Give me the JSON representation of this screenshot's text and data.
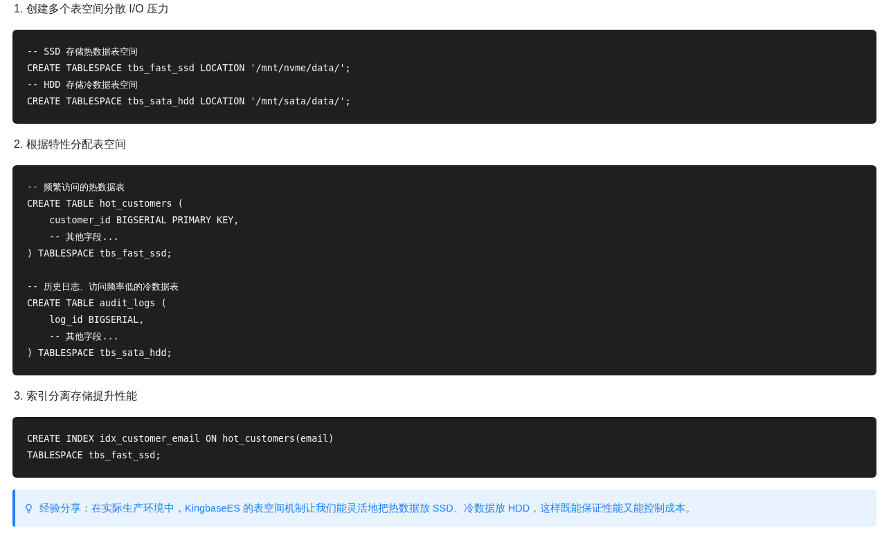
{
  "sections": [
    {
      "heading": "1. 创建多个表空间分散 I/O 压力",
      "code_groups": [
        [
          "-- SSD 存储热数据表空间",
          "CREATE TABLESPACE tbs_fast_ssd LOCATION '/mnt/nvme/data/';",
          "-- HDD 存储冷数据表空间",
          "CREATE TABLESPACE tbs_sata_hdd LOCATION '/mnt/sata/data/';"
        ]
      ]
    },
    {
      "heading": "2. 根据特性分配表空间",
      "code_groups": [
        [
          "-- 频繁访问的热数据表",
          "CREATE TABLE hot_customers (",
          "    customer_id BIGSERIAL PRIMARY KEY,",
          "    -- 其他字段...",
          ") TABLESPACE tbs_fast_ssd;"
        ],
        [
          "-- 历史日志、访问频率低的冷数据表",
          "CREATE TABLE audit_logs (",
          "    log_id BIGSERIAL,",
          "    -- 其他字段...",
          ") TABLESPACE tbs_sata_hdd;"
        ]
      ]
    },
    {
      "heading": "3. 索引分离存储提升性能",
      "code_groups": [
        [
          "CREATE INDEX idx_customer_email ON hot_customers(email)",
          "TABLESPACE tbs_fast_ssd;"
        ]
      ]
    }
  ],
  "tip": {
    "text": "经验分享：在实际生产环境中，KingbaseES 的表空间机制让我们能灵活地把热数据放 SSD、冷数据放 HDD，这样既能保证性能又能控制成本。"
  }
}
